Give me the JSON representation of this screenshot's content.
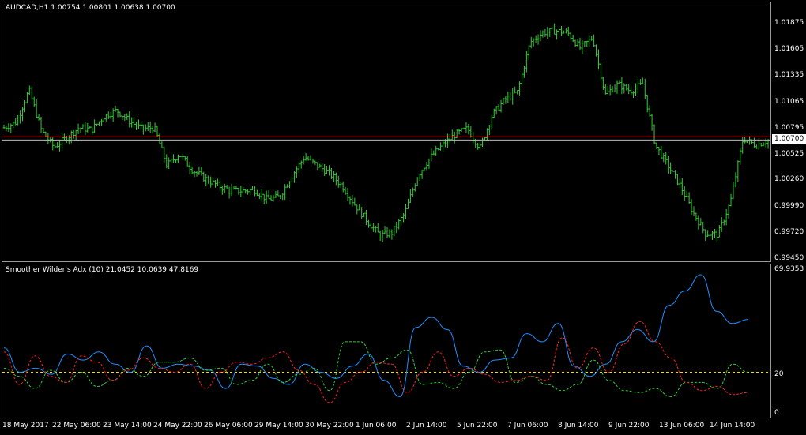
{
  "main_title": "AUDCAD,H1  1.00754 1.00801 1.00638 1.00700",
  "indicator_title": "Smoother Wilder's Adx (10) 21.0452 10.0639 47.8169",
  "current_price_label": "1.00700",
  "price_axis": [
    "1.01875",
    "1.01605",
    "1.01335",
    "1.01065",
    "1.00795",
    "1.00525",
    "1.00260",
    "0.99990",
    "0.99720",
    "0.99450"
  ],
  "indicator_axis": {
    "top": "69.9353",
    "mid": "20",
    "bottom": "0"
  },
  "time_axis": [
    "18 May 2017",
    "22 May 06:00",
    "23 May 14:00",
    "24 May 22:00",
    "26 May 06:00",
    "29 May 14:00",
    "30 May 22:00",
    "1 Jun 06:00",
    "2 Jun 14:00",
    "5 Jun 22:00",
    "7 Jun 06:00",
    "8 Jun 14:00",
    "9 Jun 22:00",
    "13 Jun 06:00",
    "14 Jun 14:00"
  ],
  "colors": {
    "bar": "#32cd32",
    "price_line": "#ff2222",
    "adx": "#1e90ff",
    "plus_di": "#32cd32",
    "minus_di": "#ff2020",
    "level": "#ffd700"
  },
  "chart_data": [
    {
      "type": "line",
      "title": "AUDCAD,H1",
      "ylim": [
        0.9945,
        1.01875
      ],
      "close_price_trace": [
        1.0081,
        1.0087,
        1.012,
        1.0078,
        1.0061,
        1.0071,
        1.0081,
        1.0079,
        1.0093,
        1.0099,
        1.0088,
        1.008,
        1.0081,
        1.0042,
        1.0054,
        1.0038,
        1.0029,
        1.0022,
        1.0016,
        1.0016,
        1.0017,
        1.0007,
        1.001,
        1.0032,
        1.0051,
        1.0042,
        1.0034,
        1.0021,
        1.0002,
        0.9985,
        0.997,
        0.9973,
        0.9993,
        1.0031,
        1.005,
        1.0063,
        1.0074,
        1.008,
        1.006,
        1.0095,
        1.011,
        1.0118,
        1.0169,
        1.0179,
        1.0181,
        1.0179,
        1.0163,
        1.0174,
        1.0115,
        1.0126,
        1.0119,
        1.0126,
        1.0063,
        1.0042,
        1.0021,
        0.9994,
        0.9972,
        0.9971,
        1.0005,
        1.007,
        1.0063,
        1.0068
      ],
      "current_price": 1.007
    },
    {
      "type": "line",
      "title": "Smoother Wilder's Adx (10)",
      "ylim": [
        0,
        69.9353
      ],
      "level": 20,
      "series": [
        {
          "values": [
            32,
            20,
            22,
            19,
            29,
            26,
            30,
            24,
            20,
            33,
            22,
            24,
            23,
            21,
            12,
            24,
            23,
            17,
            14,
            24,
            20,
            17,
            23,
            29,
            16,
            8,
            42,
            47,
            41,
            23,
            20,
            26,
            27,
            39,
            35,
            44,
            23,
            18,
            24,
            35,
            41,
            35,
            53,
            60,
            68,
            50,
            44,
            46
          ]
        },
        {
          "values": [
            22,
            18,
            12,
            21,
            15,
            20,
            13,
            16,
            22,
            18,
            25,
            25,
            27,
            21,
            22,
            14,
            16,
            24,
            15,
            19,
            22,
            11,
            35,
            35,
            24,
            27,
            31,
            14,
            15,
            12,
            20,
            30,
            31,
            15,
            18,
            14,
            11,
            14,
            26,
            16,
            11,
            10,
            12,
            8,
            15,
            15,
            12,
            24,
            20
          ]
        },
        {
          "values": [
            30,
            14,
            28,
            18,
            15,
            28,
            25,
            16,
            21,
            27,
            22,
            20,
            24,
            12,
            20,
            25,
            24,
            27,
            30,
            21,
            14,
            5,
            15,
            20,
            25,
            24,
            10,
            20,
            30,
            18,
            22,
            19,
            15,
            16,
            18,
            16,
            37,
            22,
            32,
            20,
            34,
            45,
            35,
            27,
            15,
            11,
            13,
            9,
            10
          ]
        }
      ]
    }
  ]
}
